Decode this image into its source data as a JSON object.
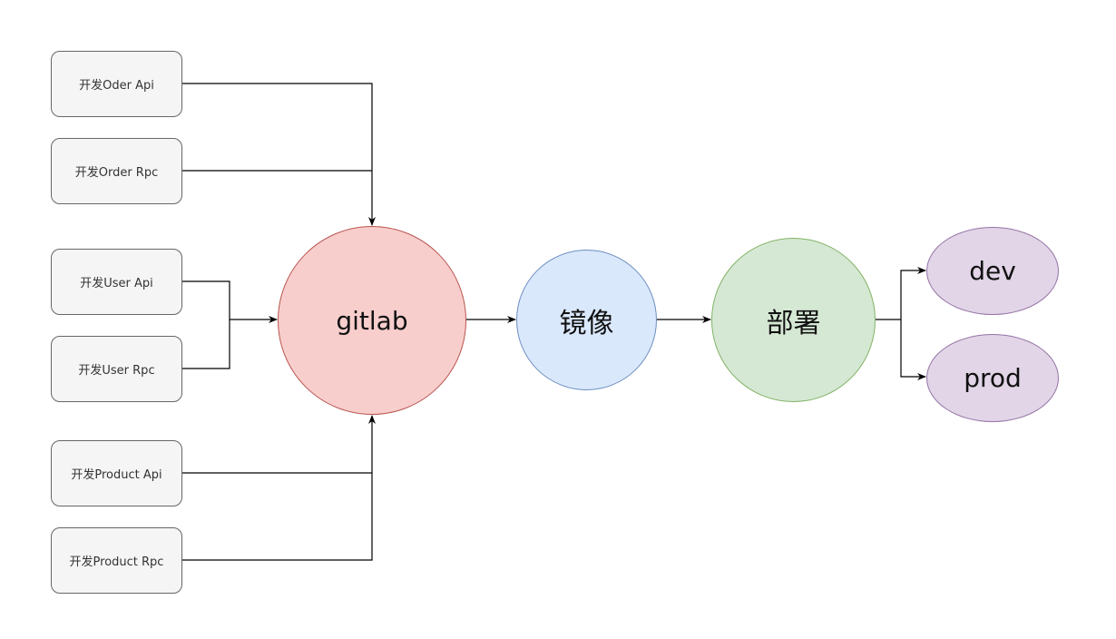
{
  "nodes": {
    "order_api": "开发Oder Api",
    "order_rpc": "开发Order Rpc",
    "user_api": "开发User Api",
    "user_rpc": "开发User Rpc",
    "product_api": "开发Product Api",
    "product_rpc": "开发Product Rpc",
    "gitlab": "gitlab",
    "mirror": "镜像",
    "deploy": "部署",
    "dev": "dev",
    "prod": "prod"
  },
  "colors": {
    "edge": "#000000",
    "box_fill": "#f5f5f5",
    "box_stroke": "#666666",
    "gitlab_fill": "#f8cecc",
    "gitlab_stroke": "#b85450",
    "mirror_fill": "#dae8fc",
    "mirror_stroke": "#6c8ebf",
    "deploy_fill": "#d5e8d4",
    "deploy_stroke": "#82b366",
    "env_fill": "#e1d5e7",
    "env_stroke": "#9673a6"
  }
}
